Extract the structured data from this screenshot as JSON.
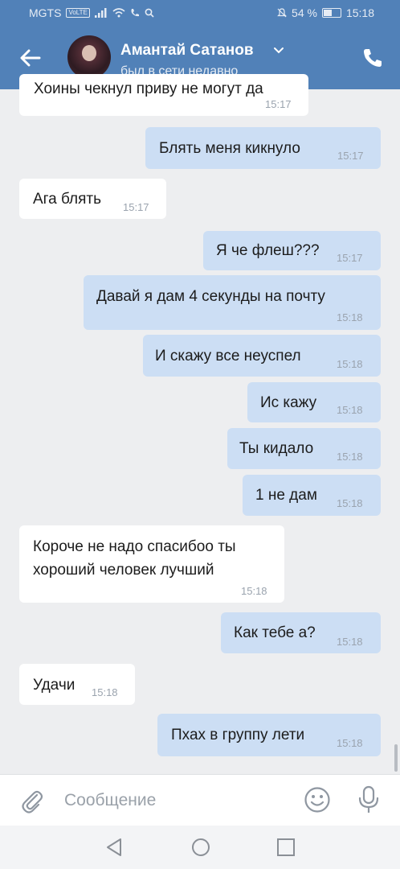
{
  "status_bar": {
    "carrier": "MGTS",
    "volte": "VoLTE",
    "battery": "54 %",
    "battery_level": 0.54,
    "time": "15:18"
  },
  "header": {
    "contact_name": "Амантай Сатанов",
    "contact_status": "был в сети недавно"
  },
  "messages": [
    {
      "dir": "in",
      "text": "Хоины чекнул приву не могут да",
      "time": "15:17"
    },
    {
      "dir": "out",
      "text": "Блять меня кикнуло",
      "time": "15:17"
    },
    {
      "dir": "in",
      "text": "Ага блять",
      "time": "15:17"
    },
    {
      "dir": "out",
      "text": "Я че флеш???",
      "time": "15:17"
    },
    {
      "dir": "out",
      "text": "Давай я дам 4 секунды на почту",
      "time": "15:18"
    },
    {
      "dir": "out",
      "text": "И скажу все неуспел",
      "time": "15:18"
    },
    {
      "dir": "out",
      "text": "Ис кажу",
      "time": "15:18"
    },
    {
      "dir": "out",
      "text": "Ты кидало",
      "time": "15:18"
    },
    {
      "dir": "out",
      "text": "1 не дам",
      "time": "15:18"
    },
    {
      "dir": "in",
      "text_lines": [
        "Короче не надо спасибоо ты",
        "хороший человек лучший"
      ],
      "time": "15:18"
    },
    {
      "dir": "out",
      "text": "Как тебе а?",
      "time": "15:18"
    },
    {
      "dir": "in",
      "text": "Удачи",
      "time": "15:18"
    },
    {
      "dir": "out",
      "text": "Пхах в группу лети",
      "time": "15:18"
    }
  ],
  "composer": {
    "placeholder": "Сообщение"
  },
  "icons": {
    "back": "arrow-left-icon",
    "dropdown": "chevron-down-icon",
    "call": "phone-icon",
    "attach": "paperclip-icon",
    "emoji": "smile-icon",
    "voice": "microphone-icon"
  },
  "colors": {
    "header": "#5181b8",
    "outgoing_bubble": "#ccdef4",
    "incoming_bubble": "#ffffff",
    "background": "#edeef0"
  }
}
